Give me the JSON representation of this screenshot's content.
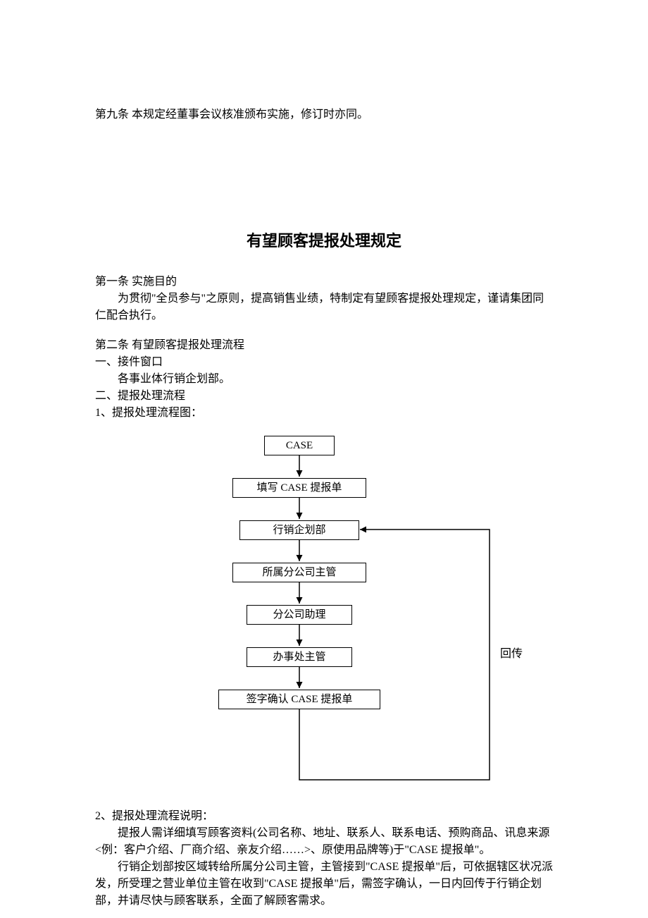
{
  "top_note": "第九条  本规定经董事会议核准颁布实施，修订时亦同。",
  "title": "有望顾客提报处理规定",
  "a1_head": "第一条  实施目的",
  "a1_body": "为贯彻\"全员参与\"之原则，提高销售业绩，特制定有望顾客提报处理规定，谨请集团同仁配合执行。",
  "a2_head": "第二条  有望顾客提报处理流程",
  "a2_l1": "一、接件窗口",
  "a2_l1b": "各事业体行销企划部。",
  "a2_l2": "二、提报处理流程",
  "a2_l3": "1、提报处理流程图：",
  "flow": {
    "b1": "CASE",
    "b2": "填写 CASE 提报单",
    "b3": "行销企划部",
    "b4": "所属分公司主管",
    "b5": "分公司助理",
    "b6": "办事处主管",
    "b7": "签字确认 CASE 提报单",
    "back": "回传"
  },
  "a2_l4": "2、提报处理流程说明：",
  "a2_p1": "提报人需详细填写顾客资料(公司名称、地址、联系人、联系电话、预购商品、讯息来源<例：客户介绍、厂商介绍、亲友介绍……>、原使用品牌等)于\"CASE 提报单\"。",
  "a2_p2": "行销企划部按区域转给所属分公司主管，主管接到\"CASE 提报单\"后，可依据辖区状况派发，所受理之营业单位主管在收到\"CASE 提报单\"后，需签字确认，一日内回传于行销企划部，并请尽快与顾客联系，全面了解顾客需求。"
}
